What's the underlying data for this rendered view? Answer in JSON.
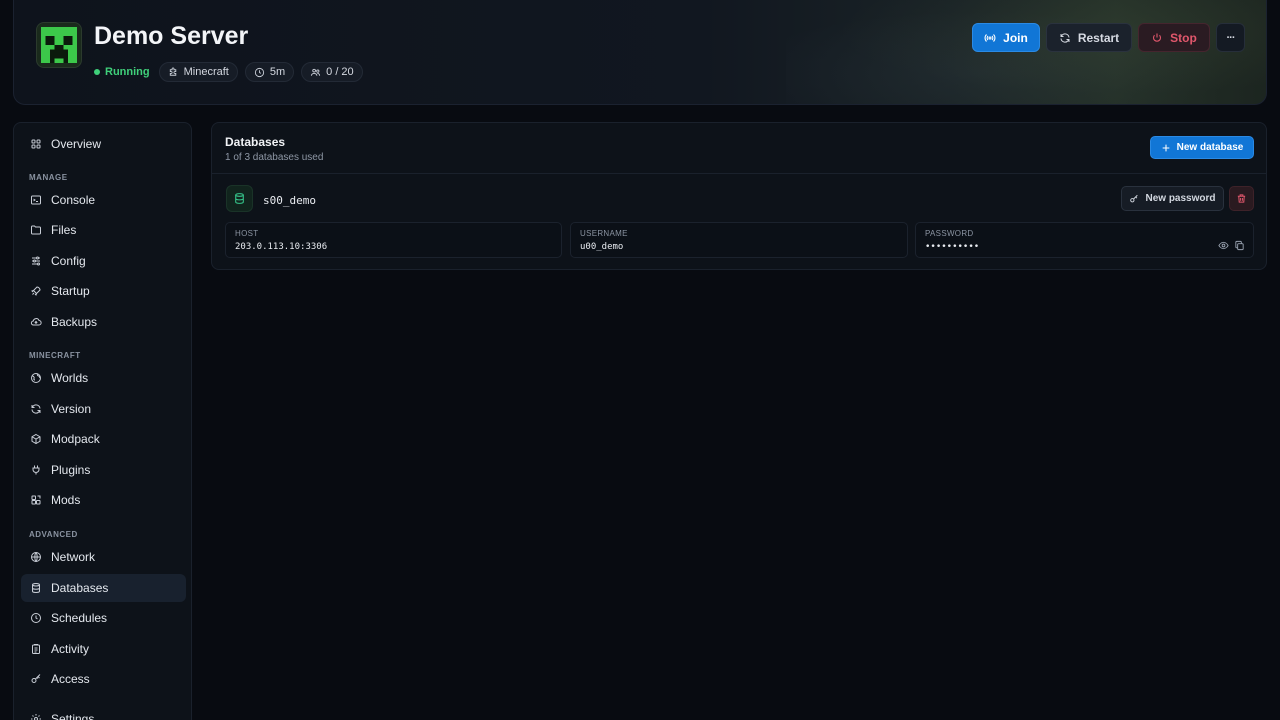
{
  "header": {
    "title": "Demo Server",
    "status": "Running",
    "game": "Minecraft",
    "uptime": "5m",
    "players": "0 / 20",
    "buttons": {
      "join": "Join",
      "restart": "Restart",
      "stop": "Stop",
      "more": "···"
    }
  },
  "sidebar": {
    "overview": "Overview",
    "sections": {
      "manage": "MANAGE",
      "minecraft": "MINECRAFT",
      "advanced": "ADVANCED"
    },
    "items": {
      "console": "Console",
      "files": "Files",
      "config": "Config",
      "startup": "Startup",
      "backups": "Backups",
      "worlds": "Worlds",
      "version": "Version",
      "modpack": "Modpack",
      "plugins": "Plugins",
      "mods": "Mods",
      "network": "Network",
      "databases": "Databases",
      "schedules": "Schedules",
      "activity": "Activity",
      "access": "Access",
      "settings": "Settings"
    },
    "active": "databases"
  },
  "panel": {
    "title": "Databases",
    "subtitle": "1 of 3 databases used",
    "new_database_label": "New database",
    "database": {
      "name": "s00_demo",
      "new_password_label": "New password",
      "host_label": "HOST",
      "host": "203.0.113.10:3306",
      "username_label": "USERNAME",
      "username": "u00_demo",
      "password_label": "PASSWORD",
      "password_masked": "••••••••••"
    }
  },
  "colors": {
    "accent": "#1176d6",
    "running": "#3fd07a",
    "danger": "#e1576c",
    "db_icon": "#35c48a"
  }
}
